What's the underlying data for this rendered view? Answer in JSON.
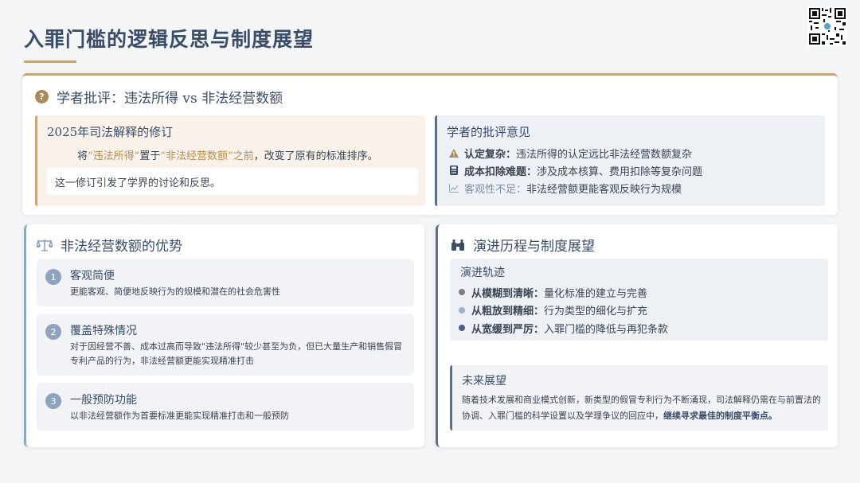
{
  "page": {
    "title": "入罪门槛的逻辑反思与制度展望"
  },
  "top": {
    "heading": "学者批评：违法所得 vs 非法经营数额",
    "revision": {
      "title": "2025年司法解释的修订",
      "text_pre": "将",
      "hl1": "“违法所得”",
      "text_mid": "置于",
      "hl2": "“非法经营数额”之前",
      "text_post": "，改变了原有的标准排序。",
      "note": "这一修订引发了学界的讨论和反思。"
    },
    "critique": {
      "title": "学者的批评意见",
      "items": [
        {
          "icon": "warning-icon",
          "key": "认定复杂：",
          "text": "违法所得的认定远比非法经营数额复杂"
        },
        {
          "icon": "calculator-icon",
          "key": "成本扣除难题：",
          "text": "涉及成本核算、费用扣除等复杂问题"
        },
        {
          "icon": "chart-icon",
          "key": "客观性不足：",
          "text": "非法经营额更能客观反映行为规模"
        }
      ]
    }
  },
  "advantages": {
    "heading": "非法经营数额的优势",
    "items": [
      {
        "num": "1",
        "title": "客观简便",
        "desc": "更能客观、简便地反映行为的规模和潜在的社会危害性"
      },
      {
        "num": "2",
        "title": "覆盖特殊情况",
        "desc": "对于因经营不善、成本过高而导致\"违法所得\"较少甚至为负，但已大量生产和销售假冒专利产品的行为，非法经营额更能实现精准打击"
      },
      {
        "num": "3",
        "title": "一般预防功能",
        "desc": "以非法经营额作为首要标准更能实现精准打击和一般预防"
      }
    ]
  },
  "evolution": {
    "heading": "演进历程与制度展望",
    "track_title": "演进轨迹",
    "items": [
      {
        "key": "从模糊到清晰：",
        "text": "量化标准的建立与完善",
        "color": "#7f7f7f"
      },
      {
        "key": "从粗放到精细：",
        "text": "行为类型的细化与扩充",
        "color": "#9fb0c6"
      },
      {
        "key": "从宽缓到严厉：",
        "text": "入罪门槛的降低与再犯条款",
        "color": "#4e6080"
      }
    ],
    "future": {
      "title": "未来展望",
      "text": "随着技术发展和商业模式创新，新类型的假冒专利行为不断涌现，司法解释仍需在与前置法的协调、入罪门槛的科学设置以及学理争议的回应中，",
      "emphasis": "继续寻求最佳的制度平衡点。"
    }
  }
}
